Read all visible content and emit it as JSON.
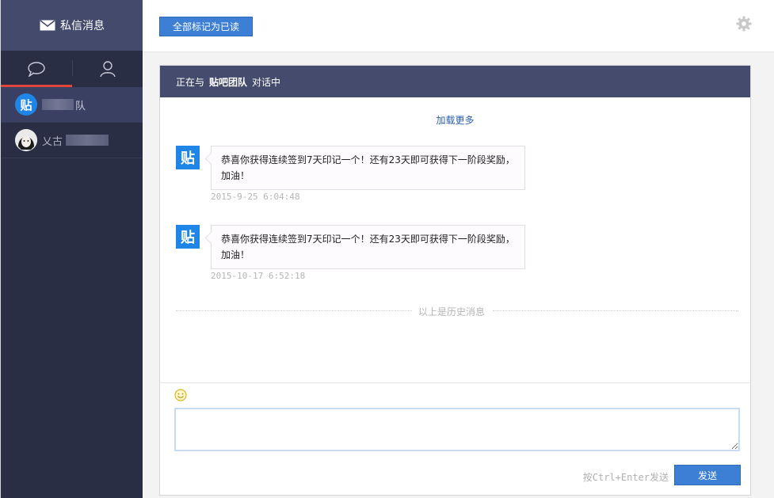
{
  "sidebar": {
    "title": "私信消息",
    "title_icon": "mail-icon",
    "tabs": [
      {
        "icon": "chat-bubble-icon",
        "active": true
      },
      {
        "icon": "person-icon",
        "active": false
      }
    ],
    "conversations": [
      {
        "name_visible": "队",
        "avatar_text": "贴",
        "active": true
      },
      {
        "name_visible": "乂古",
        "active": false
      }
    ]
  },
  "toolbar": {
    "mark_all_read_label": "全部标记为已读",
    "settings_icon": "gear-icon"
  },
  "chat": {
    "header_prefix": "正在与",
    "header_name": "贴吧团队",
    "header_suffix": "对话中",
    "load_more_label": "加载更多",
    "messages": [
      {
        "avatar_text": "贴",
        "text": "恭喜你获得连续签到7天印记一个！还有23天即可获得下一阶段奖励，加油！",
        "time": "2015-9-25 6:04:48"
      },
      {
        "avatar_text": "贴",
        "text": "恭喜你获得连续签到7天印记一个！还有23天即可获得下一阶段奖励，加油！",
        "time": "2015-10-17 6:52:18"
      }
    ],
    "history_divider_label": "以上是历史消息"
  },
  "composer": {
    "emoji_icon": "smiley-icon",
    "textarea_value": "",
    "send_hint": "按Ctrl+Enter发送",
    "send_label": "发送"
  },
  "colors": {
    "sidebar_bg": "#2a2e45",
    "sidebar_header_bg": "#434a6b",
    "accent_blue": "#3c7fd4",
    "active_tab_bar": "#e1473b",
    "chat_header_bg": "#444b6c"
  }
}
